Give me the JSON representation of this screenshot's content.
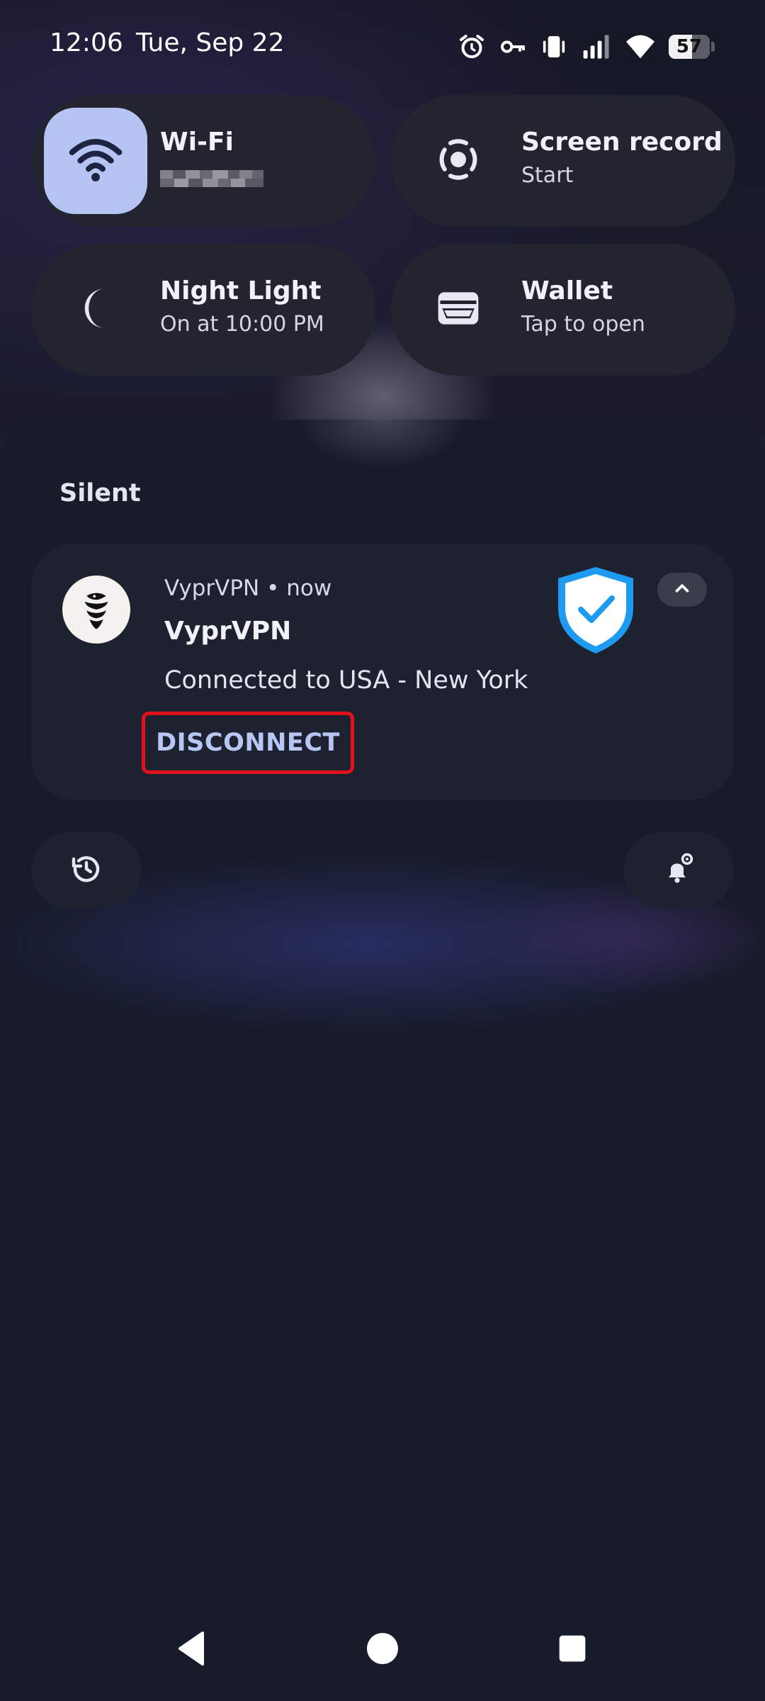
{
  "status_bar": {
    "time": "12:06",
    "date": "Tue, Sep 22",
    "battery": "57",
    "battery_level_percent": 57,
    "icons": [
      "alarm-icon",
      "vpn-key-icon",
      "vibrate-icon",
      "signal-icon",
      "wifi-icon",
      "battery-icon"
    ]
  },
  "tiles": [
    {
      "title": "Wi-Fi",
      "subtitle": "",
      "icon": "wifi-icon",
      "active": true
    },
    {
      "title": "Screen record",
      "subtitle": "Start",
      "icon": "screen-record-icon",
      "active": false
    },
    {
      "title": "Night Light",
      "subtitle": "On at 10:00 PM",
      "icon": "moon-icon",
      "active": false
    },
    {
      "title": "Wallet",
      "subtitle": "Tap to open",
      "icon": "wallet-icon",
      "active": false
    }
  ],
  "notifications": {
    "section_label": "Silent",
    "items": [
      {
        "app_line": "VyprVPN • now",
        "title": "VyprVPN",
        "text": "Connected to USA - New York",
        "action": "DISCONNECT",
        "icon": "vyprvpn-logo-icon",
        "large_icon": "shield-check-icon"
      }
    ]
  },
  "footer_buttons": [
    "notification-history-icon",
    "notification-settings-icon"
  ],
  "nav_bar": [
    "back-icon",
    "home-icon",
    "recents-icon"
  ],
  "colors": {
    "background": "#171b2a",
    "tile": "#22242f",
    "tile_active": "#b5c4f3",
    "action_text": "#b8c6f4",
    "highlight_border": "#e0101e",
    "shield_blue": "#1e9bf0"
  }
}
